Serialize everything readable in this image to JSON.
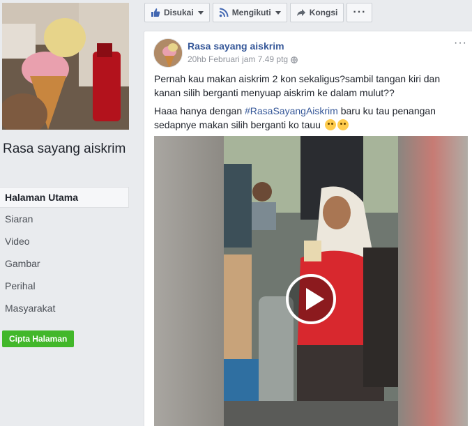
{
  "page": {
    "name": "Rasa sayang aiskrim"
  },
  "nav": {
    "items": [
      {
        "label": "Halaman Utama",
        "active": true
      },
      {
        "label": "Siaran"
      },
      {
        "label": "Video"
      },
      {
        "label": "Gambar"
      },
      {
        "label": "Perihal"
      },
      {
        "label": "Masyarakat"
      }
    ],
    "create_page_label": "Cipta Halaman"
  },
  "actions": {
    "liked_label": "Disukai",
    "following_label": "Mengikuti",
    "share_label": "Kongsi",
    "more_label": "···"
  },
  "post": {
    "author": "Rasa sayang aiskrim",
    "timestamp": "20hb Februari jam 7.49 ptg",
    "options_label": "···",
    "text_line1": "Pernah kau makan aiskrim 2 kon sekaligus?sambil tangan kiri dan kanan silih berganti menyuap aiskrim ke dalam mulut??",
    "text_line2_prefix": "Haaa hanya dengan ",
    "hashtag": "#RasaSayangAiskrim",
    "text_line2_suffix": " baru ku tau penangan sedapnye makan silih berganti ko tauu "
  },
  "colors": {
    "link": "#365899",
    "create_button": "#42b72a",
    "background": "#e9ebee"
  }
}
